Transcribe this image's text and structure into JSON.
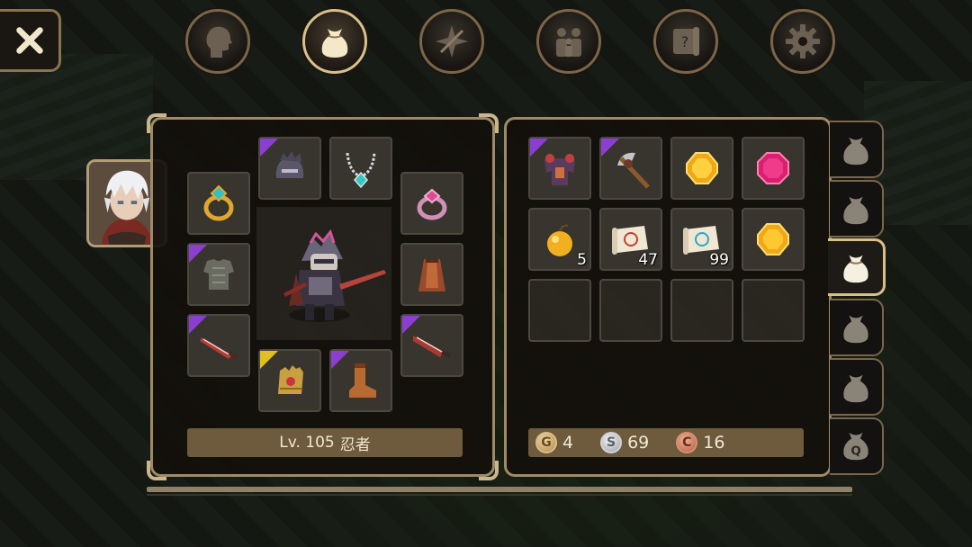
{
  "top_tabs": [
    {
      "icon": "profile-head-icon",
      "active": false
    },
    {
      "icon": "bag-icon",
      "active": true
    },
    {
      "icon": "skill-icon",
      "active": false
    },
    {
      "icon": "party-icon",
      "active": false
    },
    {
      "icon": "quest-scroll-icon",
      "active": false
    },
    {
      "icon": "settings-gear-icon",
      "active": false
    }
  ],
  "character": {
    "level_label": "Lv. 105",
    "class_name": "忍者"
  },
  "equipment_slots": [
    {
      "slot": "ring-left",
      "icon": "gold-ring-icon",
      "rarity": null
    },
    {
      "slot": "helmet",
      "icon": "dark-helmet-icon",
      "rarity": "epic"
    },
    {
      "slot": "necklace",
      "icon": "crystal-necklace-icon",
      "rarity": null
    },
    {
      "slot": "ring-right",
      "icon": "pink-ring-icon",
      "rarity": null
    },
    {
      "slot": "armor",
      "icon": "chain-armor-icon",
      "rarity": "epic"
    },
    {
      "slot": "cape",
      "icon": "leather-cape-icon",
      "rarity": null
    },
    {
      "slot": "weapon-left",
      "icon": "crimson-sword-icon",
      "rarity": "epic"
    },
    {
      "slot": "weapon-right",
      "icon": "crimson-blade-icon",
      "rarity": "epic"
    },
    {
      "slot": "gloves",
      "icon": "golden-gauntlet-icon",
      "rarity": "legendary"
    },
    {
      "slot": "boots",
      "icon": "leather-boots-icon",
      "rarity": "epic"
    }
  ],
  "inventory": {
    "items": [
      {
        "icon": "demon-armor-icon",
        "rarity": "epic",
        "qty": ""
      },
      {
        "icon": "battle-axe-icon",
        "rarity": "epic",
        "qty": ""
      },
      {
        "icon": "topaz-gem-icon",
        "rarity": null,
        "qty": ""
      },
      {
        "icon": "ruby-gem-icon",
        "rarity": null,
        "qty": ""
      },
      {
        "icon": "golden-apple-icon",
        "rarity": null,
        "qty": "5"
      },
      {
        "icon": "red-scroll-icon",
        "rarity": null,
        "qty": "47"
      },
      {
        "icon": "blue-scroll-icon",
        "rarity": null,
        "qty": "99"
      },
      {
        "icon": "amber-gem-icon",
        "rarity": null,
        "qty": ""
      },
      {
        "icon": "empty-slot",
        "rarity": null,
        "qty": ""
      },
      {
        "icon": "empty-slot",
        "rarity": null,
        "qty": ""
      },
      {
        "icon": "empty-slot",
        "rarity": null,
        "qty": ""
      },
      {
        "icon": "empty-slot",
        "rarity": null,
        "qty": ""
      }
    ]
  },
  "currency": {
    "gold": {
      "symbol": "G",
      "amount": "4"
    },
    "silver": {
      "symbol": "S",
      "amount": "69"
    },
    "copper": {
      "symbol": "C",
      "amount": "16"
    }
  },
  "side_tabs": [
    {
      "icon": "bag-icon",
      "label": "",
      "active": false
    },
    {
      "icon": "bag-icon",
      "label": "",
      "active": false
    },
    {
      "icon": "bag-icon",
      "label": "",
      "active": true
    },
    {
      "icon": "bag-icon",
      "label": "",
      "active": false
    },
    {
      "icon": "bag-icon",
      "label": "",
      "active": false
    },
    {
      "icon": "quest-bag-icon",
      "label": "Q",
      "active": false
    }
  ],
  "colors": {
    "epic": "#8a3fd1",
    "legendary": "#e0c020",
    "panel_border": "#a08a66",
    "bar": "#6e5a3c"
  }
}
